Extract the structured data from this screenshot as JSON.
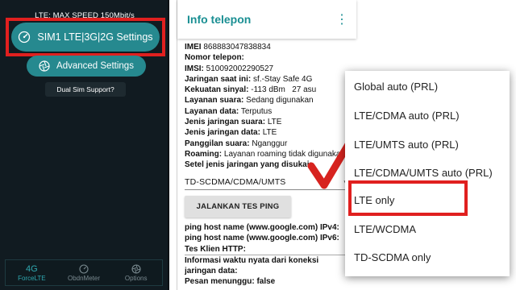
{
  "left_app": {
    "top_status": "LTE: MAX SPEED 150Mbit/s",
    "sim_button": "SIM1 LTE|3G|2G Settings",
    "advanced_button": "Advanced Settings",
    "dual_sim_button": "Dual Sim Support?",
    "nav": [
      {
        "icon": "4G",
        "label": "ForceLTE"
      },
      {
        "icon": "gauge-icon",
        "label": "ObdnMeter"
      },
      {
        "icon": "settings-icon",
        "label": "Options"
      }
    ],
    "accent": "#26898f",
    "highlight": "#e0201f"
  },
  "info_app": {
    "title": "Info telepon",
    "rows": [
      {
        "label": "IMEI",
        "value": "868883047838834"
      },
      {
        "label": "Nomor telepon:",
        "value": ""
      },
      {
        "label": "IMSI:",
        "value": "510092002290527"
      },
      {
        "label": "Jaringan saat ini:",
        "value": "sf.-Stay Safe 4G"
      },
      {
        "label": "Kekuatan sinyal:",
        "value": "-113 dBm   27 asu"
      },
      {
        "label": "Layanan suara:",
        "value": "Sedang digunakan"
      },
      {
        "label": "Layanan data:",
        "value": "Terputus"
      },
      {
        "label": "Jenis jaringan suara:",
        "value": "LTE"
      },
      {
        "label": "Jenis jaringan data:",
        "value": "LTE"
      },
      {
        "label": "Panggilan suara:",
        "value": "Nganggur"
      },
      {
        "label": "Roaming:",
        "value": "Layanan roaming tidak digunakan"
      },
      {
        "label": "Setel jenis jaringan yang disukai:",
        "value": ""
      }
    ],
    "network_select": "TD-SCDMA/CDMA/UMTS",
    "ping_button": "JALANKAN TES PING",
    "ping_rows": [
      "ping host name (www.google.com) IPv4:",
      "ping host name (www.google.com) IPv6:",
      "Tes Klien HTTP:",
      "Informasi waktu nyata dari koneksi jaringan data:",
      "Pesan menunggu: false"
    ]
  },
  "dropdown": {
    "options": [
      "Global auto (PRL)",
      "LTE/CDMA auto (PRL)",
      "LTE/UMTS auto (PRL)",
      "LTE/CDMA/UMTS auto (PRL)",
      "LTE only",
      "LTE/WCDMA",
      "TD-SCDMA only"
    ],
    "highlighted": "LTE only"
  }
}
